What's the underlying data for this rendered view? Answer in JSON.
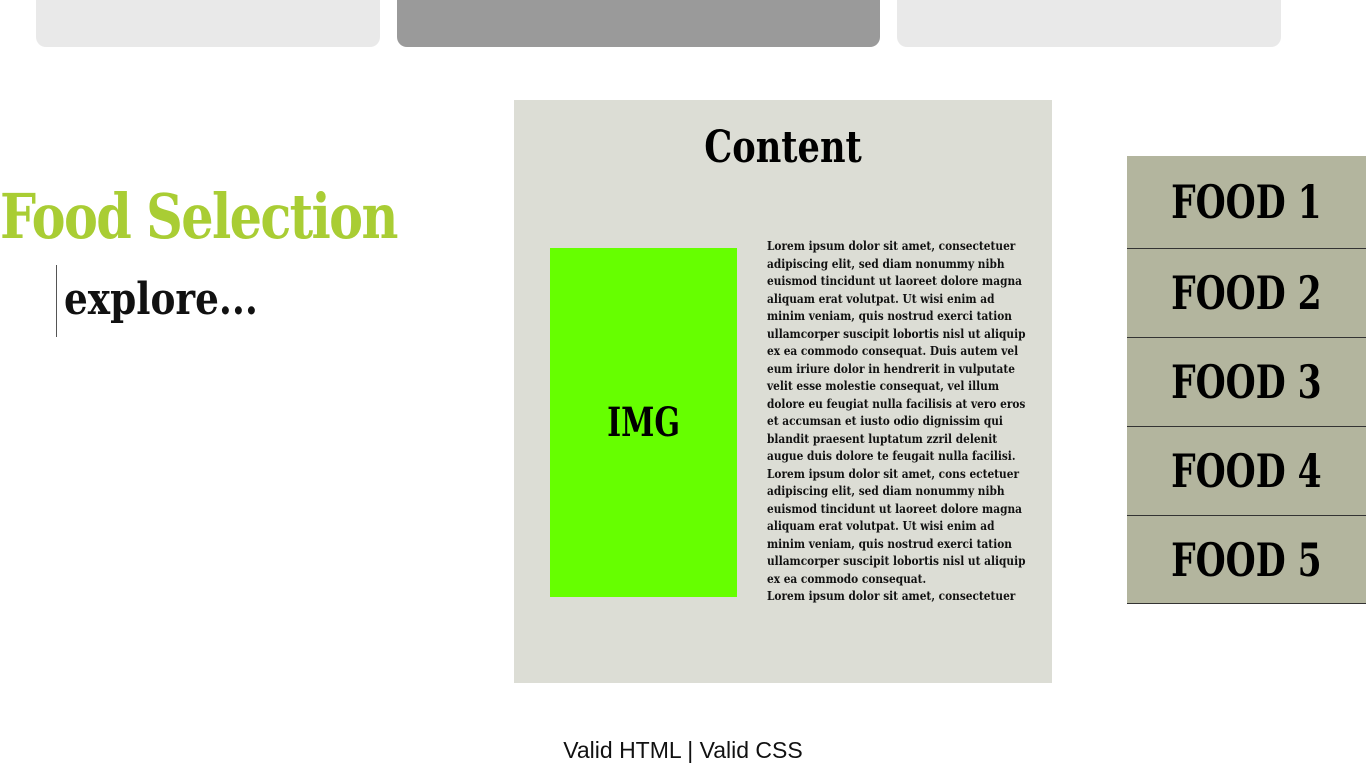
{
  "nav": {
    "tabs": [
      {
        "label": ""
      },
      {
        "label": ""
      },
      {
        "label": ""
      }
    ],
    "active_tab": 1,
    "colors": {
      "tab": "#e9e9e9",
      "active_tab": "#9a9a9a"
    }
  },
  "header": {
    "title": "Food Selection",
    "subtitle": "explore...",
    "title_color": "#a9cd34"
  },
  "content": {
    "heading": "Content",
    "image_label": "IMG",
    "image_color": "#66ff00",
    "paragraphs": [
      "Lorem ipsum dolor sit amet, consectetuer adipiscing elit, sed diam nonummy nibh euismod tincidunt ut laoreet dolore magna aliquam erat volutpat. Ut wisi enim ad minim veniam, quis nostrud exerci tation ullamcorper suscipit lobortis nisl ut aliquip ex ea commodo consequat. Duis autem vel eum iriure dolor in hendrerit in vulputate velit esse molestie consequat, vel illum dolore eu feugiat nulla facilisis at vero eros et accumsan et iusto odio dignissim qui blandit praesent luptatum zzril delenit augue duis dolore te feugait nulla facilisi.",
      "Lorem ipsum dolor sit amet, cons ectetuer adipiscing elit, sed diam nonummy nibh euismod tincidunt ut laoreet dolore magna aliquam erat volutpat. Ut wisi enim ad minim veniam, quis nostrud exerci tation ullamcorper suscipit lobortis nisl ut aliquip ex ea commodo consequat.",
      "Lorem ipsum dolor sit amet, consectetuer"
    ]
  },
  "food_menu": {
    "items": [
      {
        "label": "FOOD 1"
      },
      {
        "label": "FOOD 2"
      },
      {
        "label": "FOOD 3"
      },
      {
        "label": "FOOD 4"
      },
      {
        "label": "FOOD 5"
      }
    ],
    "color": "#b3b59e"
  },
  "footer": {
    "valid_html": "Valid HTML",
    "separator": " | ",
    "valid_css": "Valid CSS"
  }
}
